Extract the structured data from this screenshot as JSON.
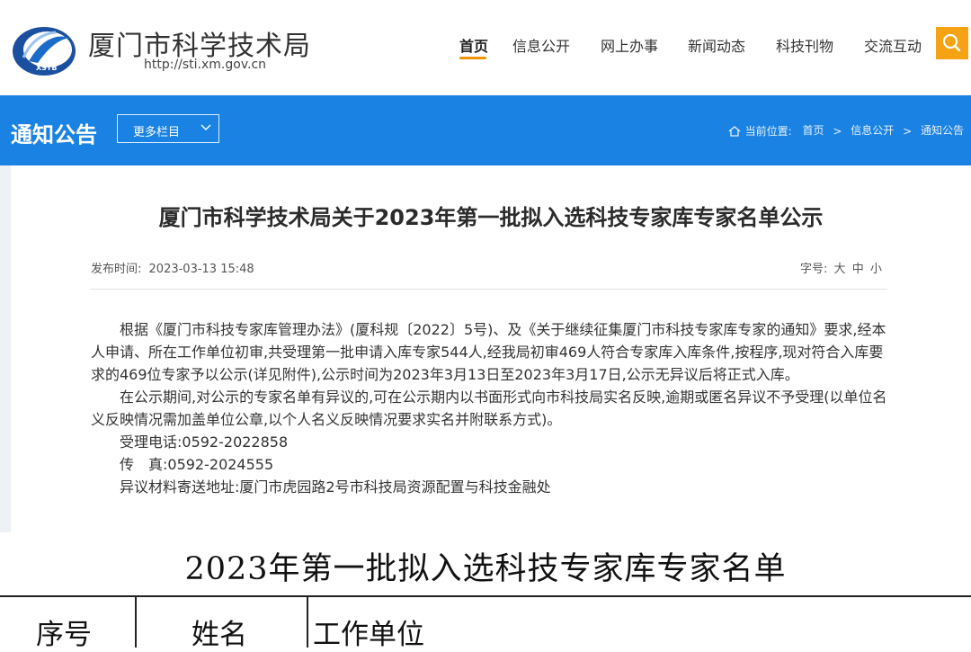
{
  "header": {
    "site_title": "厦门市科学技术局",
    "site_url": "http://sti.xm.gov.cn",
    "logo_text": "XSTB",
    "nav": [
      "首页",
      "信息公开",
      "网上办事",
      "新闻动态",
      "科技刊物",
      "交流互动"
    ],
    "active_nav": "首页",
    "search_icon": "search-icon",
    "accent_color": "#f5a314"
  },
  "banner": {
    "title": "通知公告",
    "more_label": "更多栏目",
    "breadcrumb_label": "当前位置:",
    "breadcrumb": [
      "首页",
      "信息公开",
      "通知公告"
    ],
    "color": "#1a82e2"
  },
  "article": {
    "title": "厦门市科学技术局关于2023年第一批拟入选科技专家库专家名单公示",
    "publish_label": "发布时间:",
    "publish_time": "2023-03-13 15:48",
    "fontsize_label": "字号:",
    "fontsize_options": [
      "大",
      "中",
      "小"
    ],
    "paragraphs": [
      "根据《厦门市科技专家库管理办法》(厦科规〔2022〕5号)、及《关于继续征集厦门市科技专家库专家的通知》要求,经本人申请、所在工作单位初审,共受理第一批申请入库专家544人,经我局初审469人符合专家库入库条件,按程序,现对符合入库要求的469位专家予以公示(详见附件),公示时间为2023年3月13日至2023年3月17日,公示无异议后将正式入库。",
      "在公示期间,对公示的专家名单有异议的,可在公示期内以书面形式向市科技局实名反映,逾期或匿名异议不予受理(以单位名义反映情况需加盖单位公章,以个人名义反映情况要求实名并附联系方式)。"
    ],
    "contacts": [
      "受理电话:0592-2022858",
      "传　真:0592-2024555",
      "异议材料寄送地址:厦门市虎园路2号市科技局资源配置与科技金融处"
    ]
  },
  "list_image": {
    "title": "2023年第一批拟入选科技专家库专家名单",
    "headers": [
      "序号",
      "姓名",
      "工作单位"
    ]
  }
}
